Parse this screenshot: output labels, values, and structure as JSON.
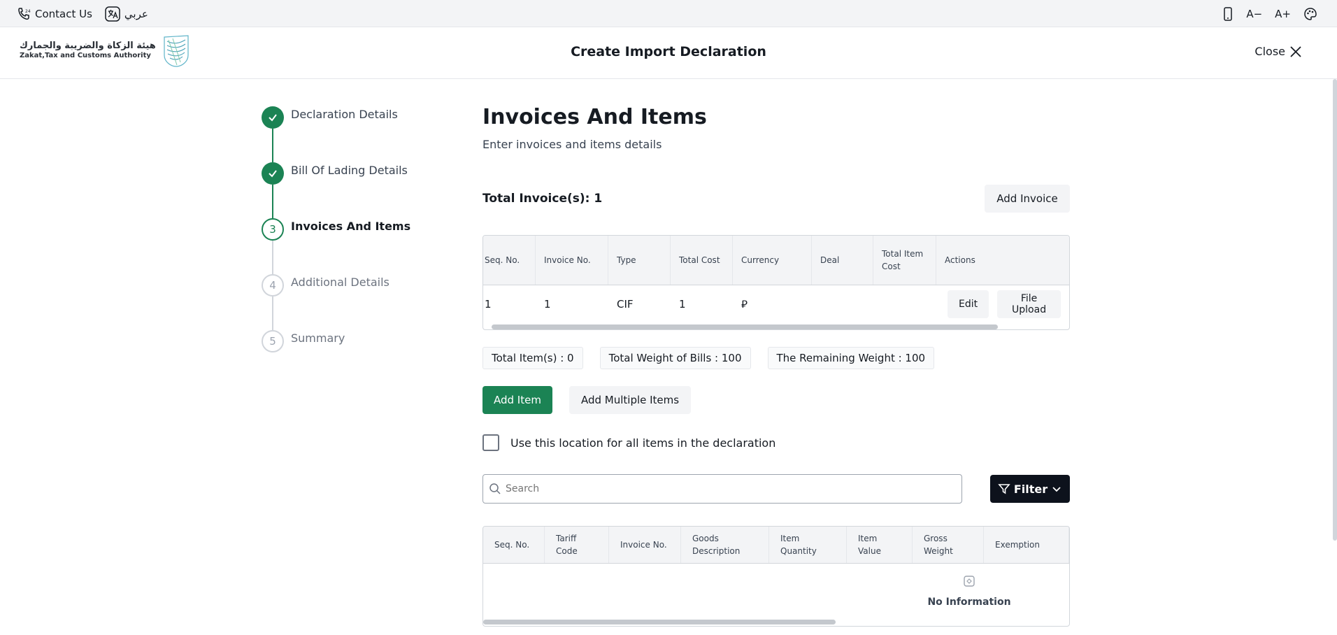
{
  "utility_bar": {
    "contact_label": "Contact Us",
    "language_label": "عربي",
    "font_decrease": "A−",
    "font_increase": "A+"
  },
  "header": {
    "logo_ar": "هيئة الزكاة والضريبة والجمارك",
    "logo_en": "Zakat,Tax and Customs Authority",
    "title": "Create Import Declaration",
    "close_label": "Close"
  },
  "stepper": {
    "steps": [
      {
        "number": "1",
        "label": "Declaration Details",
        "state": "done"
      },
      {
        "number": "2",
        "label": "Bill Of Lading Details",
        "state": "done"
      },
      {
        "number": "3",
        "label": "Invoices And Items",
        "state": "active"
      },
      {
        "number": "4",
        "label": "Additional Details",
        "state": "pending"
      },
      {
        "number": "5",
        "label": "Summary",
        "state": "pending"
      }
    ]
  },
  "main": {
    "title": "Invoices And Items",
    "subtitle": "Enter invoices and items details",
    "total_invoices": "Total Invoice(s): 1",
    "add_invoice_label": "Add Invoice"
  },
  "invoice_table": {
    "headers": [
      "Seq. No.",
      "Invoice No.",
      "Type",
      "Total Cost",
      "Currency",
      "Deal",
      "Total Item Cost",
      "Actions"
    ],
    "rows": [
      {
        "seq": "1",
        "invoice_no": "1",
        "type": "CIF",
        "total_cost": "1",
        "currency": "⃁",
        "deal": "",
        "total_item_cost": "",
        "edit_label": "Edit",
        "upload_label": "File Upload"
      }
    ]
  },
  "summary_chips": {
    "total_items": "Total Item(s) : 0",
    "total_weight": "Total Weight of Bills : 100",
    "remaining_weight": "The Remaining Weight : 100"
  },
  "item_actions": {
    "add_item_label": "Add Item",
    "add_multiple_label": "Add Multiple Items"
  },
  "location_checkbox": {
    "label": "Use this location for all items in the declaration",
    "checked": false
  },
  "search": {
    "placeholder": "Search",
    "value": ""
  },
  "filter": {
    "label": "Filter"
  },
  "items_table": {
    "headers": [
      "Seq. No.",
      "Tariff Code",
      "Invoice No.",
      "Goods Description",
      "Item Quantity",
      "Item Value",
      "Gross Weight",
      "Exemption"
    ],
    "empty_label": "No Information"
  },
  "colors": {
    "primary": "#1b8354",
    "dark": "#0d121c"
  }
}
